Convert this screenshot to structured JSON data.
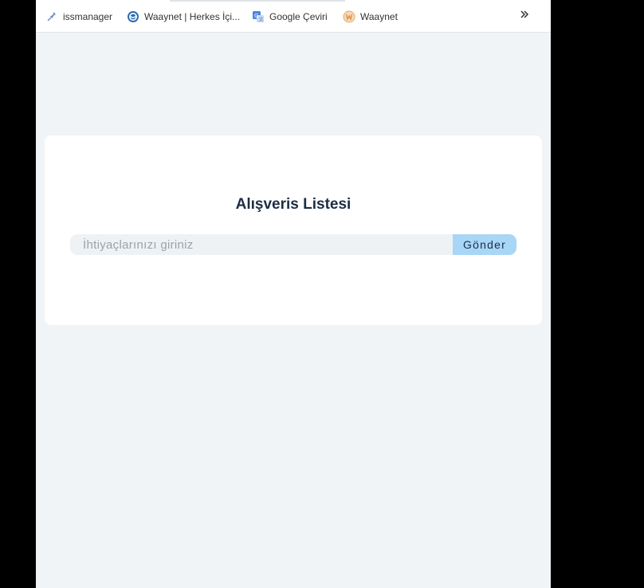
{
  "bookmarks_bar": {
    "items": [
      {
        "label": "issmanager",
        "icon": "pin-icon"
      },
      {
        "label": "Waaynet | Herkes İçi...",
        "icon": "waaynet-globe-icon"
      },
      {
        "label": "Google Çeviri",
        "icon": "google-translate-icon"
      },
      {
        "label": "Waaynet",
        "icon": "waaynet-logo-icon"
      }
    ],
    "overflow_icon": "double-chevron-right-icon"
  },
  "page": {
    "title": "Alışveris Listesi",
    "form": {
      "input_placeholder": "İhtiyaçlarınızı giriniz",
      "input_value": "",
      "submit_label": "Gönder"
    }
  },
  "colors": {
    "page_background": "#f0f4f7",
    "card_background": "#ffffff",
    "title_text": "#1c2d44",
    "input_background": "#eef2f5",
    "button_background": "#a8d6f6",
    "outer_background": "#000000"
  }
}
